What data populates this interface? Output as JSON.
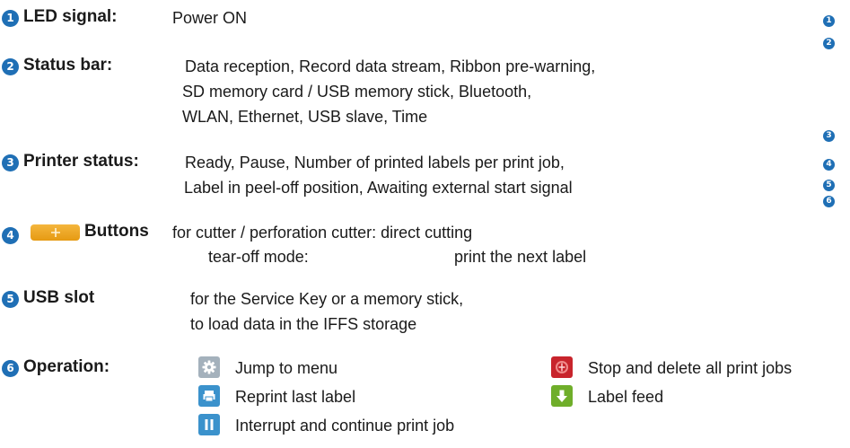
{
  "badges": [
    "1",
    "2",
    "3",
    "4",
    "5",
    "6"
  ],
  "items": {
    "led": {
      "label": "LED signal:",
      "text": "Power ON"
    },
    "status_bar": {
      "label": "Status bar:",
      "lines": [
        "Data reception, Record data stream, Ribbon pre-warning,",
        "SD memory card / USB memory stick, Bluetooth,",
        "WLAN, Ethernet, USB slave, Time"
      ]
    },
    "printer_status": {
      "label": "Printer status:",
      "lines": [
        "Ready, Pause, Number of printed labels per print job,",
        "Label in peel-off position, Awaiting external start signal"
      ]
    },
    "buttons": {
      "label": "Buttons",
      "line1": "for cutter / perforation cutter: direct cutting",
      "line2_a": "tear-off mode:",
      "line2_b": "print the next label"
    },
    "usb_slot": {
      "label": "USB slot",
      "lines": [
        "for the Service Key or a memory stick,",
        "to load data in the IFFS storage"
      ]
    },
    "operation": {
      "label": "Operation:",
      "jump_to_menu": "Jump to menu",
      "stop_delete": "Stop and delete all print jobs",
      "reprint": "Reprint last label",
      "label_feed": "Label feed",
      "interrupt": "Interrupt and continue print job"
    }
  },
  "colors": {
    "badge": "#1f6fb5",
    "menu_icon": "#a4b1bc",
    "stop_icon": "#c8242c",
    "reprint_icon": "#3b92cc",
    "feed_icon": "#6fae2a",
    "pause_icon": "#3b92cc",
    "cutter_button": "#f0a82a"
  },
  "icons": [
    "gear-icon",
    "stop-icon",
    "reprint-icon",
    "arrow-down-icon",
    "pause-icon",
    "cutter-icon"
  ]
}
